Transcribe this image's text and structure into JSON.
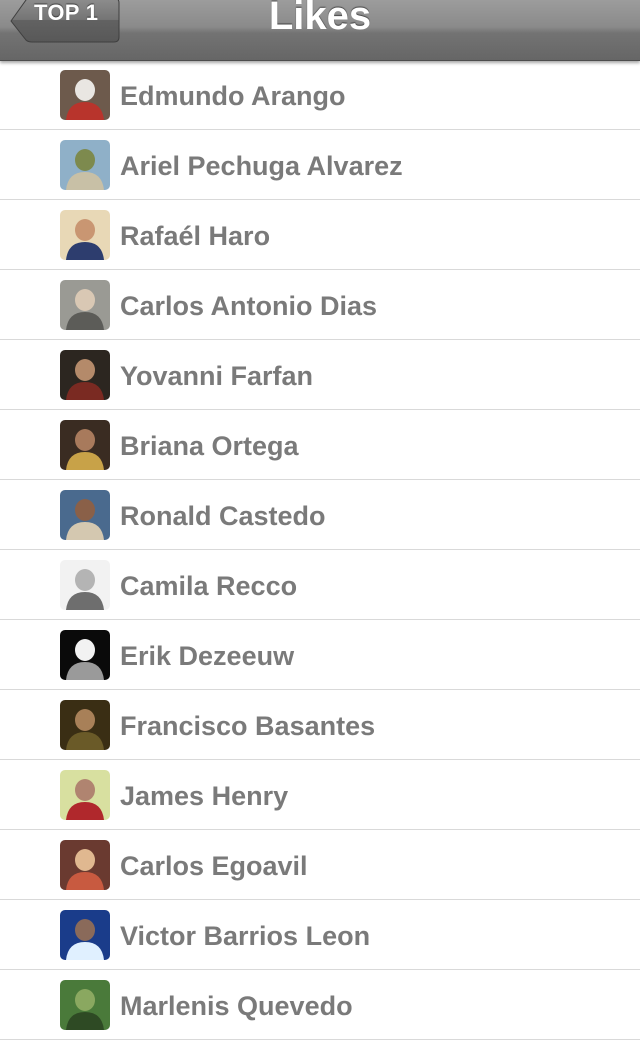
{
  "nav": {
    "title": "Likes",
    "back_label": "TOP 1"
  },
  "people": [
    {
      "name": "Edmundo Arango",
      "avatar": {
        "bg": "#6d5a4c",
        "fg": "#e9e6e2",
        "accent": "#b8342c"
      }
    },
    {
      "name": "Ariel Pechuga Alvarez",
      "avatar": {
        "bg": "#8fb0c8",
        "fg": "#7d8a4e",
        "accent": "#c8c0a6"
      }
    },
    {
      "name": "Rafaél Haro",
      "avatar": {
        "bg": "#e8d8b6",
        "fg": "#c99672",
        "accent": "#2d3d6e"
      }
    },
    {
      "name": "Carlos Antonio Dias",
      "avatar": {
        "bg": "#9a9a94",
        "fg": "#d9c8b4",
        "accent": "#5c5c58"
      }
    },
    {
      "name": "Yovanni Farfan",
      "avatar": {
        "bg": "#2c2620",
        "fg": "#b48a6a",
        "accent": "#7a2a22"
      }
    },
    {
      "name": "Briana Ortega",
      "avatar": {
        "bg": "#3a2c22",
        "fg": "#a87a5c",
        "accent": "#c8a248"
      }
    },
    {
      "name": "Ronald Castedo",
      "avatar": {
        "bg": "#4a6a8e",
        "fg": "#8a6048",
        "accent": "#d4c8b0"
      }
    },
    {
      "name": "Camila Recco",
      "avatar": {
        "bg": "#f2f2f2",
        "fg": "#b4b4b4",
        "accent": "#6e6e6e"
      }
    },
    {
      "name": "Erik Dezeeuw",
      "avatar": {
        "bg": "#0a0a0a",
        "fg": "#f2f2f2",
        "accent": "#9a9a9a"
      }
    },
    {
      "name": "Francisco Basantes",
      "avatar": {
        "bg": "#3a2e14",
        "fg": "#a88058",
        "accent": "#6a5a28"
      }
    },
    {
      "name": "James Henry",
      "avatar": {
        "bg": "#d8e0a0",
        "fg": "#b08470",
        "accent": "#b0282c"
      }
    },
    {
      "name": "Carlos Egoavil",
      "avatar": {
        "bg": "#6a3a30",
        "fg": "#e0b890",
        "accent": "#c85a40"
      }
    },
    {
      "name": "Victor Barrios Leon",
      "avatar": {
        "bg": "#1a3c8a",
        "fg": "#8a6a5a",
        "accent": "#e0f0ff"
      }
    },
    {
      "name": "Marlenis Quevedo",
      "avatar": {
        "bg": "#4a7a3a",
        "fg": "#8aa860",
        "accent": "#2e4a24"
      }
    }
  ]
}
